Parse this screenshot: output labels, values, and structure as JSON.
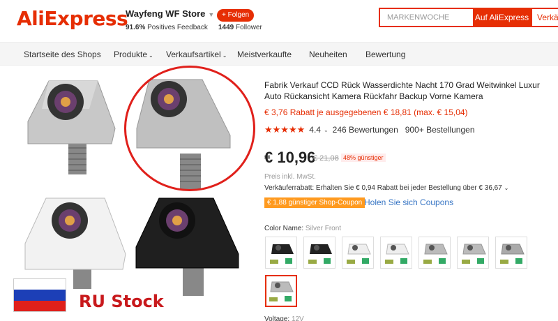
{
  "header": {
    "logo": "AliExpress",
    "store_name": "Wayfeng WF Store",
    "feedback_pct": "91.6%",
    "feedback_label": "Positives Feedback",
    "follow_label": "+ Folgen",
    "followers_count": "1449",
    "followers_label": "Follower",
    "search_placeholder": "MARKENWOCHE",
    "search_button": "Auf AliExpress",
    "search_button2": "Verkäu"
  },
  "nav": {
    "items": [
      {
        "label": "Startseite des Shops"
      },
      {
        "label": "Produkte",
        "dropdown": true
      },
      {
        "label": "Verkaufsartikel",
        "dropdown": true
      },
      {
        "label": "Meistverkaufte"
      },
      {
        "label": "Neuheiten"
      },
      {
        "label": "Bewertung"
      }
    ]
  },
  "images": {
    "overlay_text": "RU Stock"
  },
  "product": {
    "title": "Fabrik Verkauf CCD Rück Wasserdichte Nacht 170 Grad Weitwinkel Luxur Auto Rückansicht Kamera Rückfahr Backup Vorne Kamera",
    "discount_note": "€ 3,76 Rabatt je ausgegebenen € 18,81 (max. € 15,04)",
    "rating": "4.4",
    "stars": "★★★★★",
    "reviews": "246 Bewertungen",
    "orders": "900+ Bestellungen",
    "price": "€ 10,96",
    "old_price": "€ 21,08",
    "discount_badge": "48% günstiger",
    "tax_note": "Preis inkl. MwSt.",
    "seller_discount": "Verkäuferrabatt: Erhalten Sie € 0,94 Rabatt bei jeder Bestellung über € 36,67",
    "coupon": "€ 1,88 günstiger Shop-Coupon",
    "coupon_link": "Holen Sie sich Coupons",
    "color_label": "Color Name:",
    "color_value": "Silver Front",
    "voltage_label": "Voltage:",
    "voltage_value": "12V"
  },
  "swatches": [
    {
      "color": "#222"
    },
    {
      "color": "#222"
    },
    {
      "color": "#eee"
    },
    {
      "color": "#eee"
    },
    {
      "color": "#bbb"
    },
    {
      "color": "#bbb"
    },
    {
      "color": "#aaa"
    },
    {
      "color": "#bbb",
      "selected": true
    }
  ]
}
